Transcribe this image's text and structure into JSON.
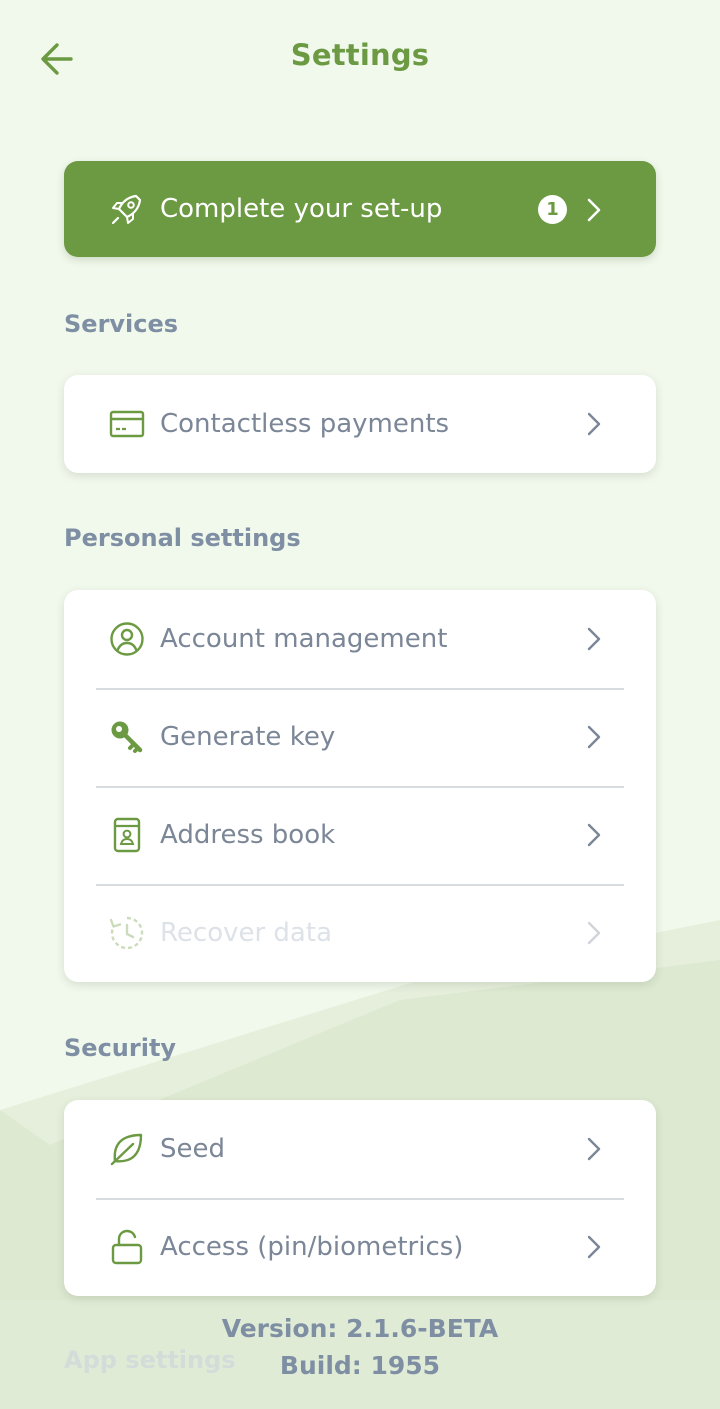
{
  "header": {
    "title": "Settings",
    "back_icon": "arrow-left-icon"
  },
  "setup_banner": {
    "label": "Complete your set-up",
    "badge_count": "1",
    "icon": "rocket-icon"
  },
  "sections": {
    "services": {
      "title": "Services",
      "items": [
        {
          "label": "Contactless payments",
          "icon": "credit-card-icon"
        }
      ]
    },
    "personal": {
      "title": "Personal settings",
      "items": [
        {
          "label": "Account management",
          "icon": "user-circle-icon"
        },
        {
          "label": "Generate key",
          "icon": "key-icon"
        },
        {
          "label": "Address book",
          "icon": "address-book-icon"
        },
        {
          "label": "Recover data",
          "icon": "history-icon",
          "disabled": true
        }
      ]
    },
    "security": {
      "title": "Security",
      "items": [
        {
          "label": "Seed",
          "icon": "leaf-icon"
        },
        {
          "label": "Access (pin/biometrics)",
          "icon": "lock-icon"
        }
      ]
    },
    "app": {
      "title": "App settings"
    }
  },
  "footer": {
    "version": "Version: 2.1.6-BETA",
    "build": "Build: 1955"
  },
  "colors": {
    "accent": "#6c9a43",
    "background": "#f1f8ec",
    "text_muted": "#7b8697",
    "section_title": "#7e8ea3"
  }
}
